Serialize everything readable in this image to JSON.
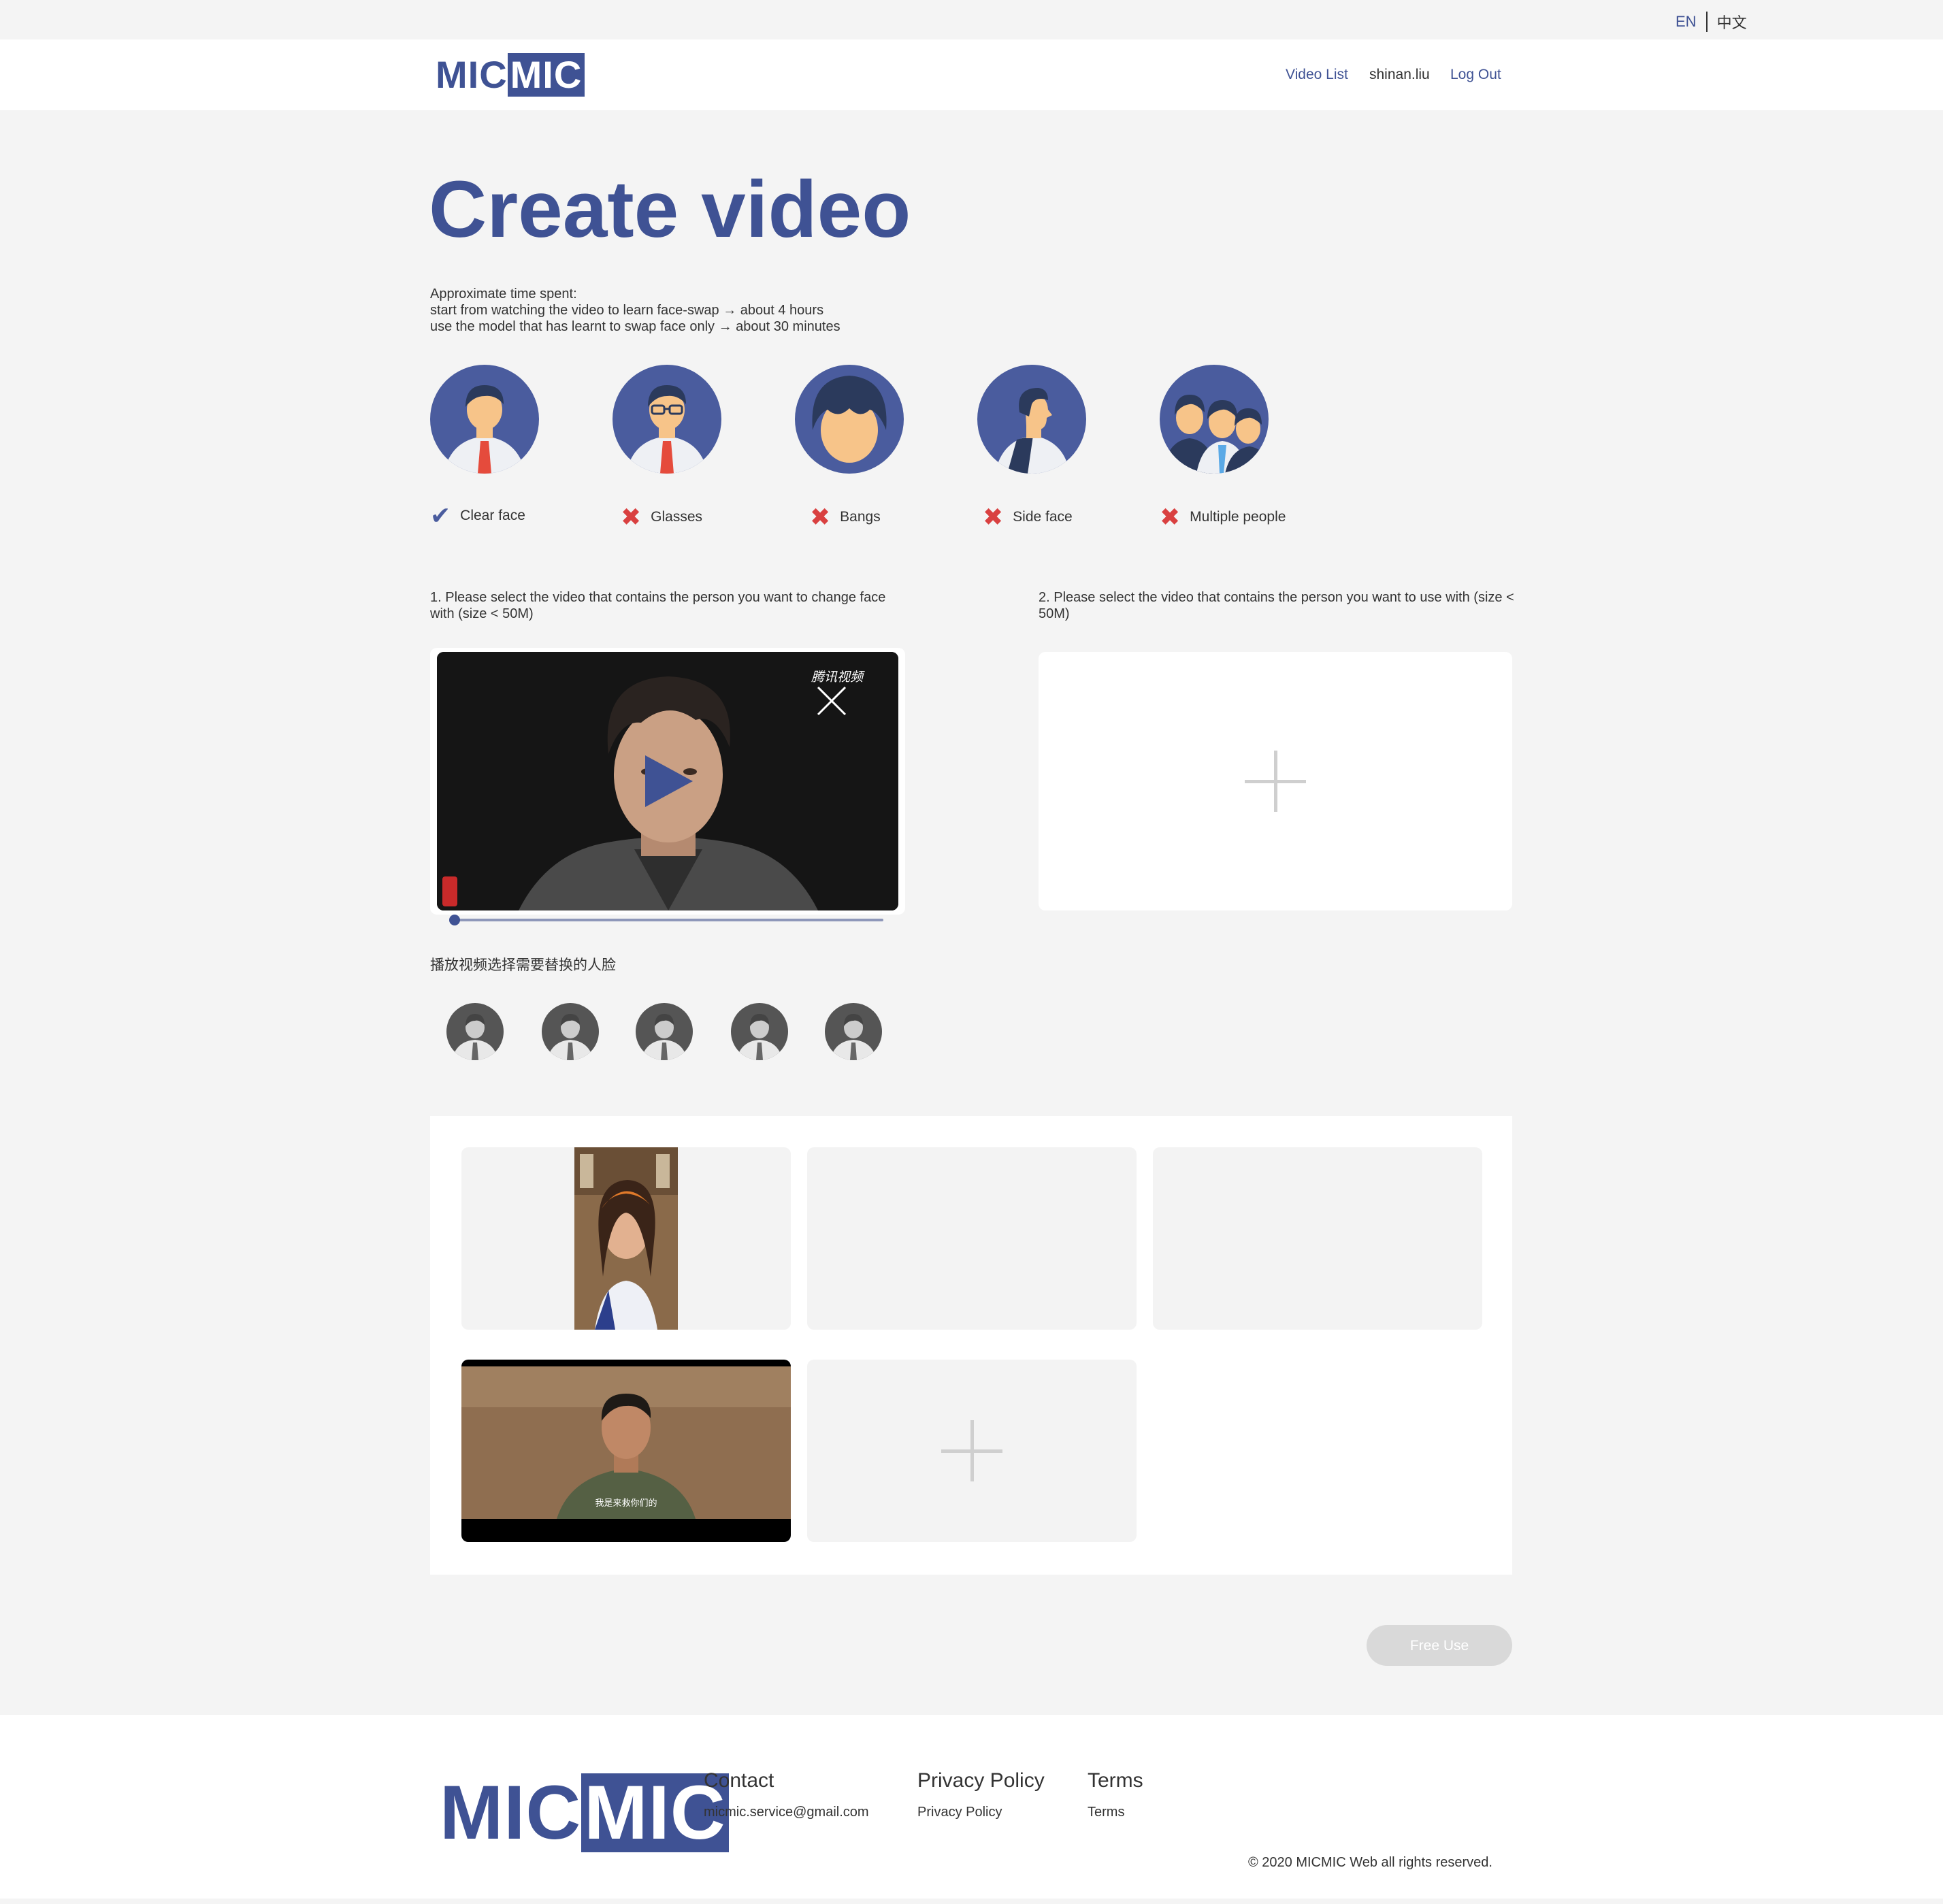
{
  "lang": {
    "en": "EN",
    "zh": "中文"
  },
  "header": {
    "logo_left": "MIC",
    "logo_right": "MIC",
    "nav_video_list": "Video List",
    "nav_user": "shinan.liu",
    "nav_logout": "Log Out"
  },
  "page_title": "Create video",
  "intro": {
    "line1": "Approximate time spent:",
    "line2": "start from watching the video to learn face-swap → about 4 hours",
    "line3": "use the model that has learnt to swap face only → about 30 minutes"
  },
  "guides": [
    {
      "label": "Clear face",
      "mark": "✔",
      "status": "ok"
    },
    {
      "label": "Glasses",
      "mark": "✖",
      "status": "bad"
    },
    {
      "label": "Bangs",
      "mark": "✖",
      "status": "bad"
    },
    {
      "label": "Side face",
      "mark": "✖",
      "status": "bad"
    },
    {
      "label": "Multiple people",
      "mark": "✖",
      "status": "bad"
    }
  ],
  "step1": "1. Please select the video that contains the person you want to change face with (size < 50M)",
  "step2": "2. Please select the video that contains the person you want to use with (size < 50M)",
  "video": {
    "watermark": "腾讯视频",
    "progress": 0.0
  },
  "faces_label": "播放视频选择需要替换的人脸",
  "library": {
    "subtitle": "我是来救你们的"
  },
  "free_use": "Free Use",
  "footer": {
    "logo_left": "MIC",
    "logo_right": "MIC",
    "contact_head": "Contact",
    "contact_email": "micmic.service@gmail.com",
    "privacy_head": "Privacy Policy",
    "privacy_link": "Privacy Policy",
    "terms_head": "Terms",
    "terms_link": "Terms",
    "copyright": "© 2020 MICMIC Web all rights reserved."
  },
  "colors": {
    "brand": "#3f5294",
    "error": "#d94040",
    "disabled": "#d9d9d9"
  }
}
